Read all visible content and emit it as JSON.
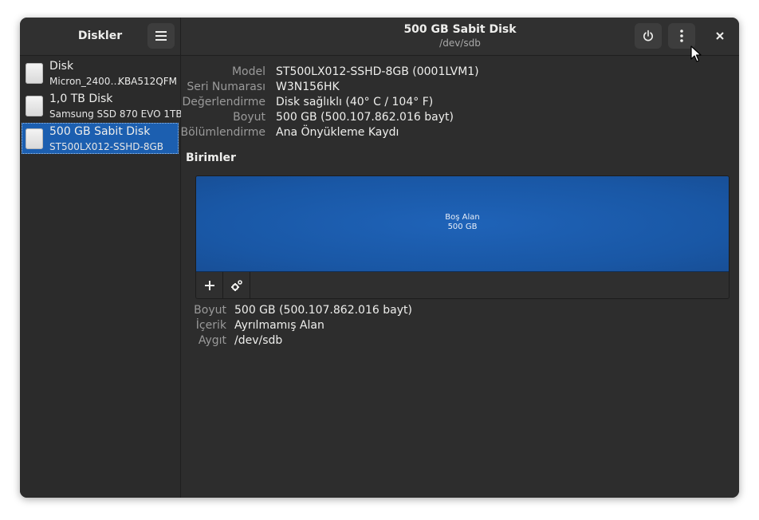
{
  "app": {
    "title": "Diskler"
  },
  "window": {
    "title": "500 GB Sabit Disk",
    "subtitle": "/dev/sdb"
  },
  "icons": {
    "menu": "hamburger-menu-icon",
    "power": "power-icon",
    "more": "vertical-dots-icon",
    "close": "close-icon",
    "disk": "harddisk-icon",
    "add": "plus-icon",
    "settings": "gears-icon"
  },
  "sidebar": {
    "items": [
      {
        "name": "Disk",
        "sub": "Micron_2400…",
        "sub_right": "KBA512QFM",
        "selected": false
      },
      {
        "name": "1,0 TB Disk",
        "sub": "Samsung SSD 870 EVO 1TB",
        "sub_right": "",
        "selected": false
      },
      {
        "name": "500 GB Sabit Disk",
        "sub": "ST500LX012-SSHD-8GB",
        "sub_right": "",
        "selected": true
      }
    ]
  },
  "disk_info": {
    "model_label": "Model",
    "model": "ST500LX012-SSHD-8GB (0001LVM1)",
    "serial_label": "Seri Numarası",
    "serial": "W3N156HK",
    "rating_label": "Değerlendirme",
    "rating": "Disk sağlıklı (40° C / 104° F)",
    "size_label": "Boyut",
    "size": "500 GB (500.107.862.016 bayt)",
    "partitioning_label": "Bölümlendirme",
    "partitioning": "Ana Önyükleme Kaydı"
  },
  "volumes": {
    "title": "Birimler",
    "block_line1": "Boş Alan",
    "block_line2": "500 GB"
  },
  "volume_info": {
    "size_label": "Boyut",
    "size": "500 GB (500.107.862.016 bayt)",
    "content_label": "İçerik",
    "content": "Ayrılmamış Alan",
    "device_label": "Aygıt",
    "device": "/dev/sdb"
  },
  "colors": {
    "accent": "#1c5fb0",
    "window_bg": "#2d2d2d",
    "volume_block": "#1957a5"
  }
}
